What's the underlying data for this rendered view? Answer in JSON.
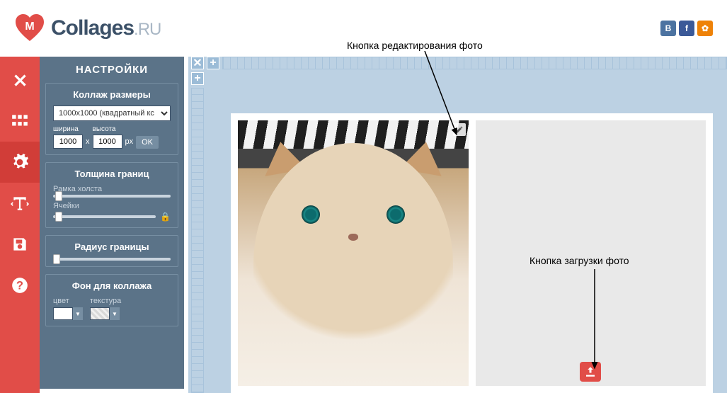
{
  "brand": {
    "name": "Collages",
    "tld": ".RU"
  },
  "social": {
    "vk": "B",
    "fb": "f",
    "ok": "✿"
  },
  "sidebar": {
    "close": "close",
    "grid": "grid",
    "settings": "settings",
    "text": "text",
    "save": "save",
    "help": "help"
  },
  "panel": {
    "title": "НАСТРОЙКИ",
    "size": {
      "title": "Коллаж размеры",
      "preset": "1000x1000 (квадратный кс",
      "w_label": "ширина",
      "h_label": "высота",
      "w": "1000",
      "h": "1000",
      "x": "x",
      "px": "px",
      "ok": "OK"
    },
    "border": {
      "title": "Толщина границ",
      "frame": "Рамка холста",
      "cells": "Ячейки"
    },
    "radius": {
      "title": "Радиус границы"
    },
    "bg": {
      "title": "Фон для коллажа",
      "color": "цвет",
      "texture": "текстура"
    }
  },
  "canvas": {
    "corner": "✕",
    "plus": "+"
  },
  "annotations": {
    "edit": "Кнопка редактирования фото",
    "upload": "Кнопка загрузки фото"
  }
}
